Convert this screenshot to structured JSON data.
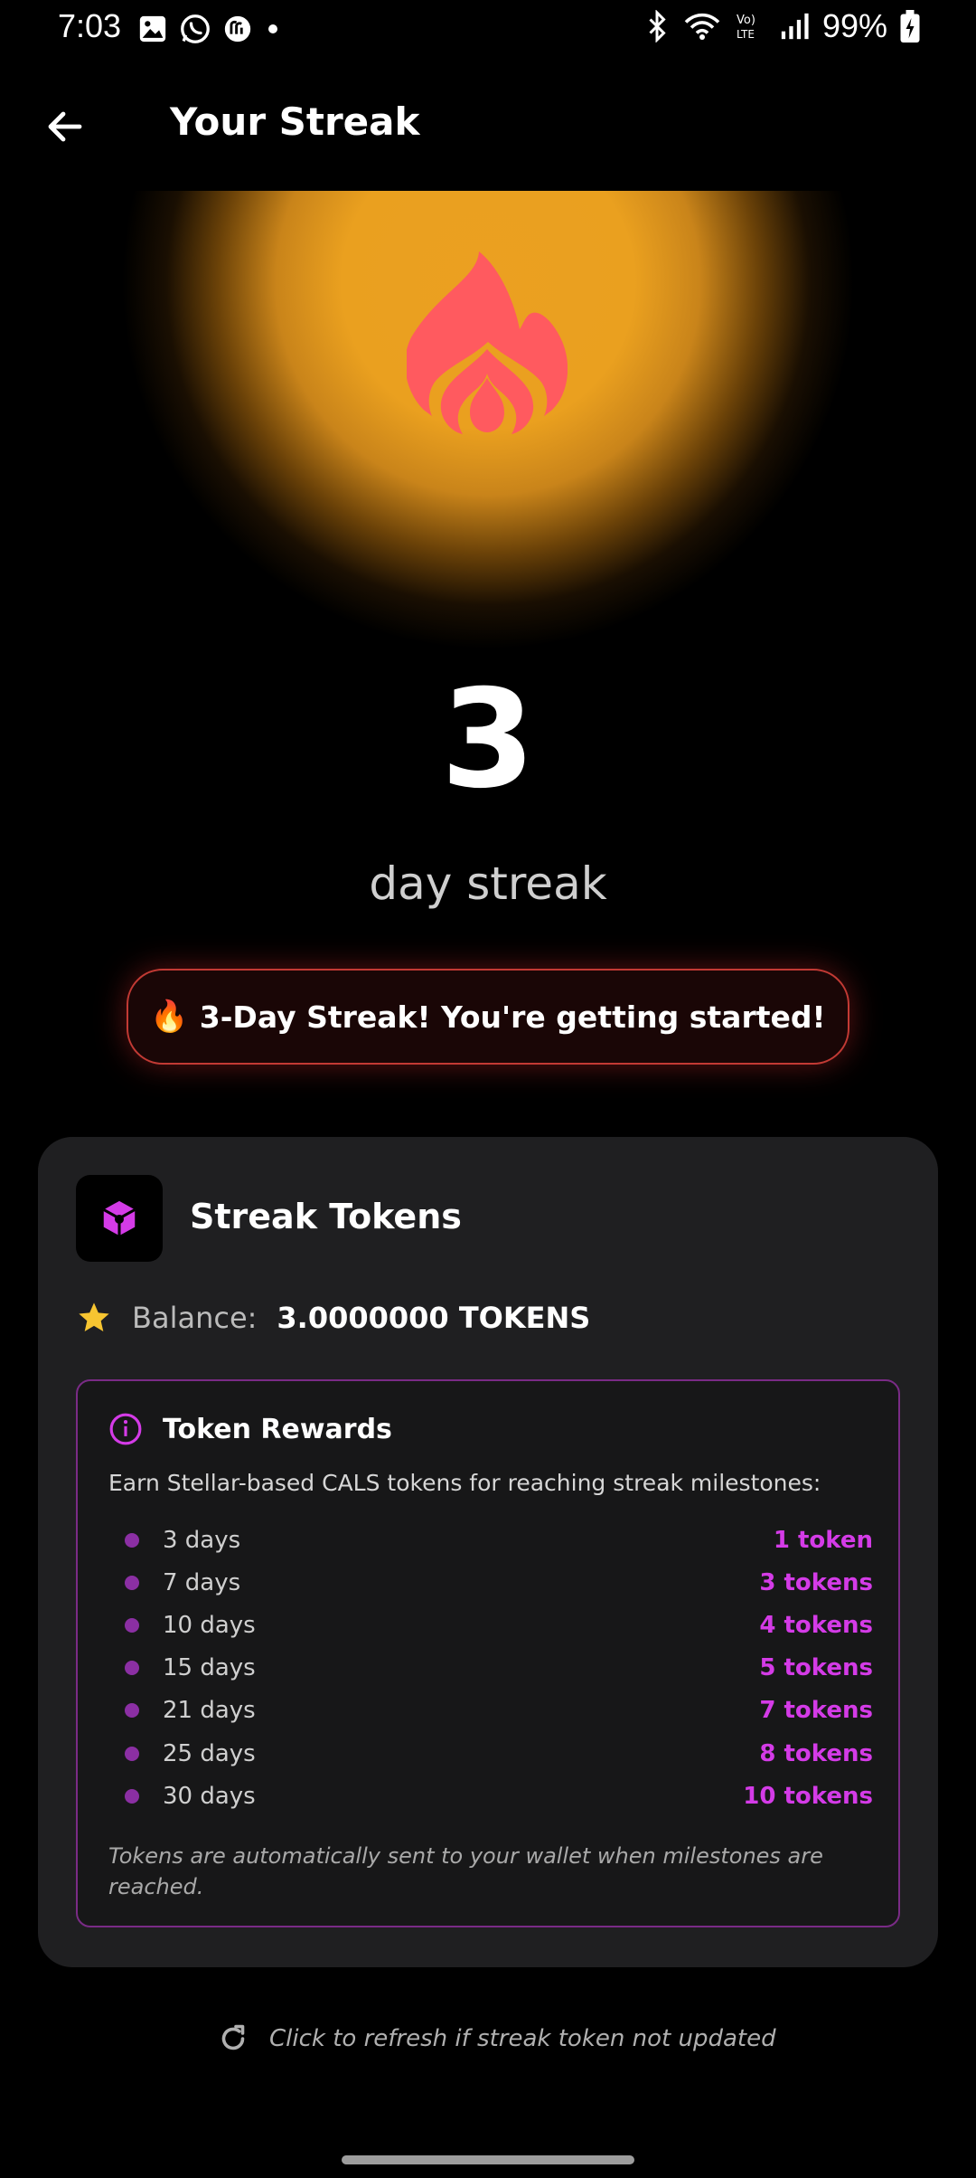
{
  "status_bar": {
    "time": "7:03",
    "battery": "99%",
    "left_icons": [
      "gallery-icon",
      "whatsapp-icon",
      "app-icon",
      "dot-icon"
    ],
    "right_icons": [
      "bluetooth-icon",
      "wifi-icon",
      "volte-icon",
      "signal-icon",
      "battery-icon"
    ]
  },
  "app_bar": {
    "title": "Your Streak",
    "back_icon": "arrow-left-icon"
  },
  "hero": {
    "icon": "flame-icon",
    "streak_count": "3",
    "streak_label": "day streak",
    "glow_color": "#eba021",
    "flame_color": "#ff5a5f"
  },
  "message": {
    "emoji": "🔥",
    "text": "3-Day Streak! You're getting started!"
  },
  "token_card": {
    "title": "Streak Tokens",
    "logo_icon": "cube-icon",
    "balance_label": "Balance:",
    "balance_value": "3.0000000 TOKENS",
    "rewards": {
      "title": "Token Rewards",
      "description": "Earn Stellar-based CALS tokens for reaching streak milestones:",
      "milestones": [
        {
          "days": "3 days",
          "tokens": "1 token"
        },
        {
          "days": "7 days",
          "tokens": "3 tokens"
        },
        {
          "days": "10 days",
          "tokens": "4 tokens"
        },
        {
          "days": "15 days",
          "tokens": "5 tokens"
        },
        {
          "days": "21 days",
          "tokens": "7 tokens"
        },
        {
          "days": "25 days",
          "tokens": "8 tokens"
        },
        {
          "days": "30 days",
          "tokens": "10 tokens"
        }
      ],
      "note": "Tokens are automatically sent to your wallet when milestones are reached."
    },
    "accent_color": "#d43be7"
  },
  "refresh": {
    "text": "Click to refresh if streak token not updated"
  }
}
